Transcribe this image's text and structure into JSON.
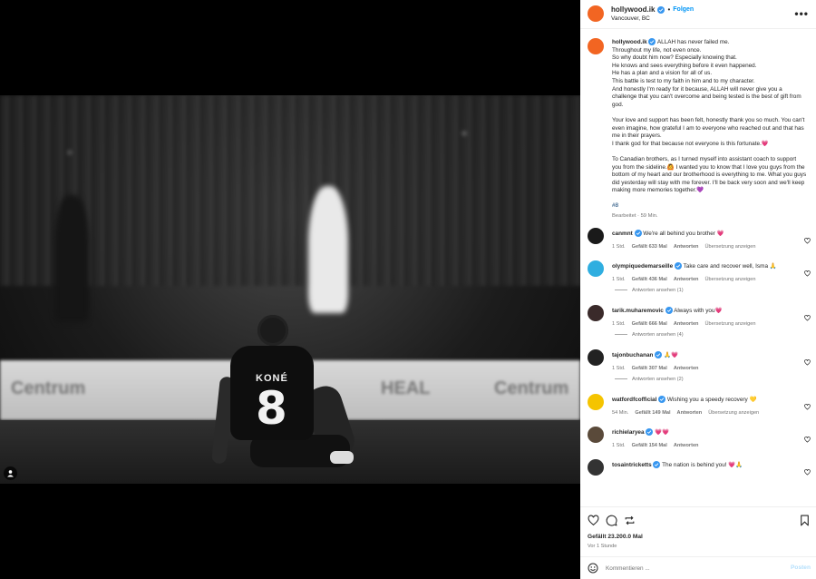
{
  "post": {
    "username": "hollywood.ik",
    "follow_label": "Folgen",
    "dot": "•",
    "location": "Vancouver, BC",
    "more_label": "•••"
  },
  "photo": {
    "jersey_name": "KONÉ",
    "jersey_number": "8",
    "board_texts": [
      "Centrum",
      "HEAL",
      "Centrum"
    ]
  },
  "caption": {
    "username": "hollywood.ik",
    "text": "ALLAH has never failed me.\nThroughout my life, not even once.\nSo why doubt him now? Especially knowing that.\nHe knows and sees everything before it even happened.\nHe has a plan and a vision for all of us.\nThis battle is test to my faith in him and to my character.\nAnd honestly I'm ready for it because, ALLAH will never give you a challenge that you can't overcome and being tested is the best of gift from god.\n\nYour love and support has been felt, honestly thank you so much. You can't even imagine, how grateful I am to everyone who reached out and that has me in their prayers.\nI thank god for that because not everyone is this fortunate.💗\n\nTo Canadian brothers, as I turned myself into assistant coach to support you from the sideline.🙆 I wanted you to know that I love you guys from the bottom of my heart and our brotherhood is everything to me. What you guys did yesterday will stay with me forever. I'll be back very soon and we'll keep making more memories together.💜",
    "hashtag": "#8",
    "meta": "Bearbeitet · 59 Min."
  },
  "comments": [
    {
      "user": "canmnt",
      "text": "We're all behind you brother 💗",
      "time": "1 Std.",
      "likes": "Gefällt 633 Mal",
      "reply": "Antworten",
      "translate": "Übersetzung anzeigen",
      "replies": "",
      "avatar_color": "#1a1a1a"
    },
    {
      "user": "olympiquedemarseille",
      "text": "Take care and recover well, Isma 🙏",
      "time": "1 Std.",
      "likes": "Gefällt 436 Mal",
      "reply": "Antworten",
      "translate": "Übersetzung anzeigen",
      "replies": "Antworten ansehen (1)",
      "avatar_color": "#2faee0"
    },
    {
      "user": "tarik.muharemovic",
      "text": "Always with you💗",
      "time": "1 Std.",
      "likes": "Gefällt 666 Mal",
      "reply": "Antworten",
      "translate": "Übersetzung anzeigen",
      "replies": "Antworten ansehen (4)",
      "avatar_color": "#3a2a2a"
    },
    {
      "user": "tajonbuchanan",
      "text": "🙏💗",
      "time": "1 Std.",
      "likes": "Gefällt 307 Mal",
      "reply": "Antworten",
      "translate": "",
      "replies": "Antworten ansehen (2)",
      "avatar_color": "#222222"
    },
    {
      "user": "watfordfcofficial",
      "text": "Wishing you a speedy recovery 💛",
      "time": "54 Min.",
      "likes": "Gefällt 149 Mal",
      "reply": "Antworten",
      "translate": "Übersetzung anzeigen",
      "replies": "",
      "avatar_color": "#f5c400"
    },
    {
      "user": "richielaryea",
      "text": "💗💗",
      "time": "1 Std.",
      "likes": "Gefällt 154 Mal",
      "reply": "Antworten",
      "translate": "",
      "replies": "",
      "avatar_color": "#5a4a3a"
    },
    {
      "user": "tosaintricketts",
      "text": "The nation is behind you! 💗🙏",
      "time": "",
      "likes": "",
      "reply": "",
      "translate": "",
      "replies": "",
      "avatar_color": "#333333"
    }
  ],
  "actions": {
    "likes": "Gefällt 23.200.0 Mal",
    "time": "Vor 1 Stunde"
  },
  "composer": {
    "placeholder": "Kommentieren ...",
    "post_label": "Posten"
  },
  "colors": {
    "accent": "#0095f6",
    "avatar": "#f26522",
    "verified": "#3897f0"
  }
}
